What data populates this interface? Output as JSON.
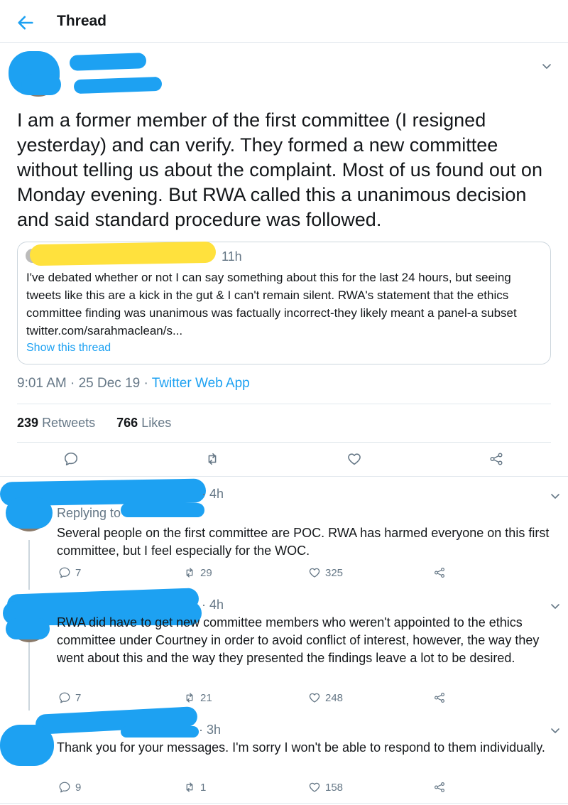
{
  "header": {
    "title": "Thread"
  },
  "main_tweet": {
    "text": "I am a former member of the first committee (I resigned yesterday) and can verify. They formed a new committee without telling us about the complaint. Most of us found out on Monday evening. But RWA called this a unanimous decision and said standard procedure was followed.",
    "quote": {
      "time": "11h",
      "text": "I've debated whether or not I can say something about this for the last 24 hours, but seeing tweets like this are a kick in the gut & I can't remain silent. RWA's statement that the ethics committee finding was unanimous was factually incorrect-they likely meant a panel-a subset twitter.com/sarahmaclean/s...",
      "show_thread": "Show this thread"
    },
    "timestamp": "9:01 AM · 25 Dec 19 · ",
    "app": "Twitter Web App",
    "retweets_count": "239",
    "retweets_label": "Retweets",
    "likes_count": "766",
    "likes_label": "Likes"
  },
  "replies": [
    {
      "time": "· 4h",
      "replying_to": "Replying to",
      "text": "Several people on the first committee are POC. RWA has harmed everyone on this first committee, but I feel especially for the WOC.",
      "replies": "7",
      "retweets": "29",
      "likes": "325"
    },
    {
      "time": "· 4h",
      "text": "RWA did have to get new committee members who weren't appointed to the ethics committee under Courtney in order to avoid conflict of interest, however, the way they went about this and the way they presented the findings leave a lot to be desired.",
      "replies": "7",
      "retweets": "21",
      "likes": "248"
    },
    {
      "time": "· 3h",
      "text": "Thank you for your messages. I'm sorry I won't be able to respond to them individually.",
      "replies": "9",
      "retweets": "1",
      "likes": "158"
    }
  ],
  "icons": {
    "back": "back-arrow-icon",
    "chevron": "chevron-down-icon",
    "reply": "reply-icon",
    "retweet": "retweet-icon",
    "like": "heart-icon",
    "share": "share-icon"
  },
  "colors": {
    "accent": "#1da1f2",
    "text": "#14171a",
    "muted": "#657786",
    "redaction_blue": "#1da1f2",
    "redaction_yellow": "#ffe13d"
  }
}
